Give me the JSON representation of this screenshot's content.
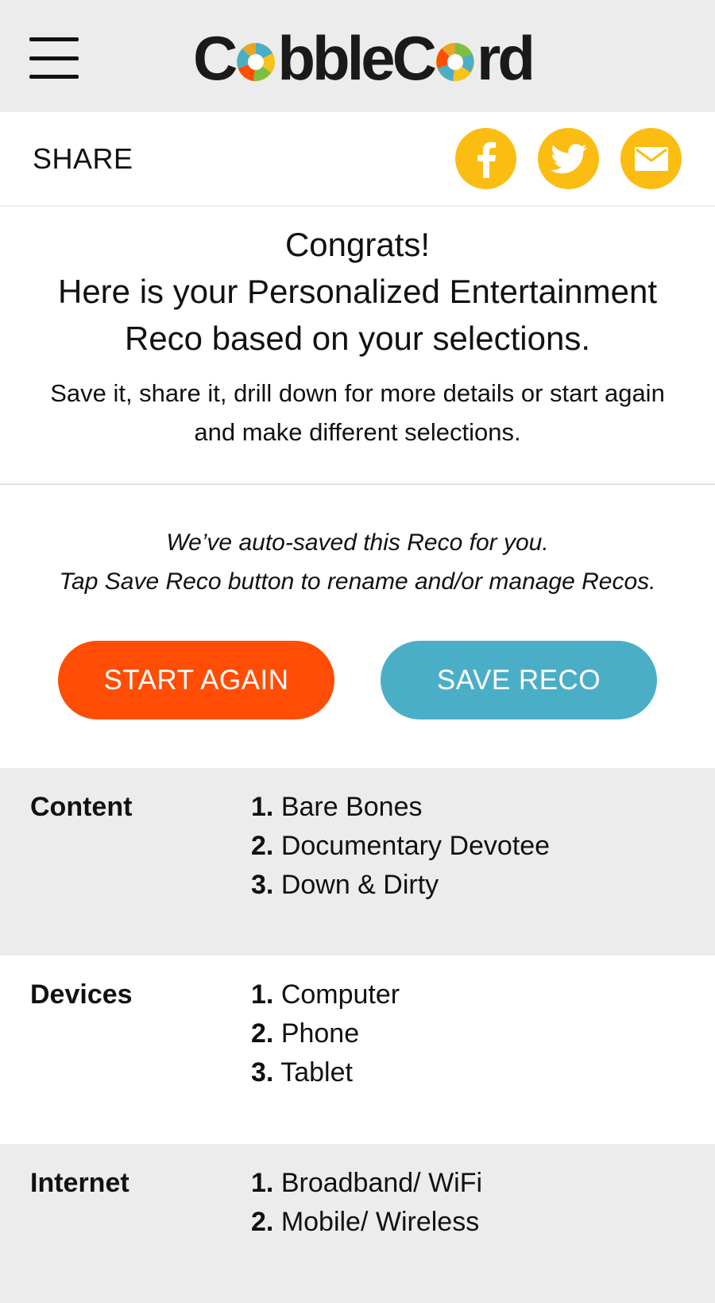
{
  "header": {
    "logo_text_prefix": "C",
    "logo_text_mid": "bbleC",
    "logo_text_suffix": "rd",
    "logo_alt": "CobbleCord",
    "menu_icon": "hamburger-menu-icon"
  },
  "share": {
    "label": "SHARE",
    "icons": [
      "facebook-icon",
      "twitter-icon",
      "email-icon"
    ],
    "icon_color": "#fbbd12"
  },
  "congrats": {
    "line1": "Congrats!",
    "line2": "Here is your Personalized Entertainment",
    "line3": "Reco based on your selections.",
    "body_line1": "Save it, share it, drill down for more details or start again",
    "body_line2": "and make different selections."
  },
  "autosave": {
    "line1": "We’ve auto-saved this Reco for you.",
    "line2": "Tap Save Reco button to rename and/or manage Recos."
  },
  "buttons": {
    "start_again": "START AGAIN",
    "save_reco": "SAVE RECO",
    "start_color": "#ff4d06",
    "save_color": "#4baec7"
  },
  "sections": [
    {
      "label": "Content",
      "items": [
        {
          "num": "1.",
          "text": "Bare Bones"
        },
        {
          "num": "2.",
          "text": "Documentary Devotee"
        },
        {
          "num": "3.",
          "text": "Down & Dirty"
        }
      ]
    },
    {
      "label": "Devices",
      "items": [
        {
          "num": "1.",
          "text": "Computer"
        },
        {
          "num": "2.",
          "text": "Phone"
        },
        {
          "num": "3.",
          "text": "Tablet"
        }
      ]
    },
    {
      "label": "Internet",
      "items": [
        {
          "num": "1.",
          "text": "Broadband/ WiFi"
        },
        {
          "num": "2.",
          "text": "Mobile/ Wireless"
        }
      ]
    }
  ]
}
